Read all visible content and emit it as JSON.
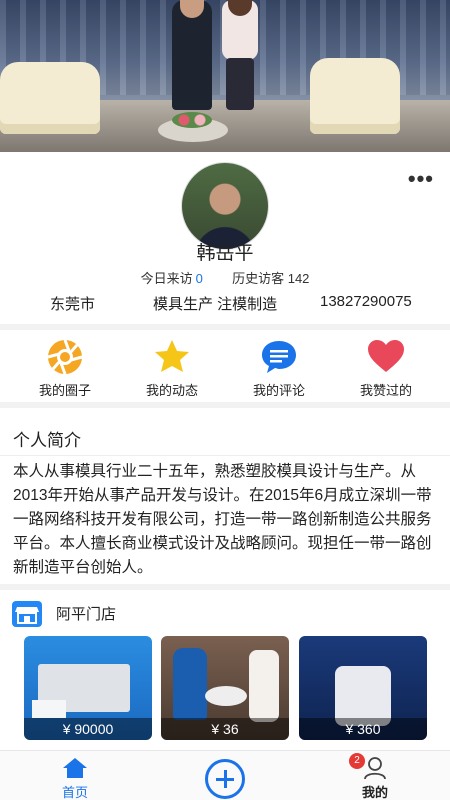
{
  "banner": {
    "alt_icon": "banner-image"
  },
  "profile": {
    "name": "韩岳平",
    "today_label": "今日来访",
    "today_value": "0",
    "history_label": "历史访客",
    "history_value": "142",
    "city": "东莞市",
    "industry": "模具生产 注模制造",
    "phone": "13827290075",
    "more_icon": "more-dots-icon"
  },
  "actions": [
    {
      "label": "我的圈子",
      "icon": "aperture-icon",
      "color": "#f5a623"
    },
    {
      "label": "我的动态",
      "icon": "star-icon",
      "color": "#f5c518"
    },
    {
      "label": "我的评论",
      "icon": "comment-icon",
      "color": "#1a73e8"
    },
    {
      "label": "我赞过的",
      "icon": "heart-icon",
      "color": "#e8485a"
    }
  ],
  "intro": {
    "title": "个人简介",
    "body": "本人从事模具行业二十五年，熟悉塑胶模具设计与生产。从2013年开始从事产品开发与设计。在2015年6月成立深圳一带一路网络科技开发有限公司，打造一带一路创新制造公共服务平台。本人擅长商业模式设计及战略顾问。现担任一带一路创新制造平台创始人。"
  },
  "shop": {
    "title": "阿平门店",
    "icon": "store-icon",
    "products": [
      {
        "price": "¥ 90000"
      },
      {
        "price": "¥ 36"
      },
      {
        "price": "¥ 360"
      }
    ]
  },
  "tabbar": {
    "home": "首页",
    "me": "我的",
    "me_badge": "2",
    "accent": "#1a73e8"
  }
}
